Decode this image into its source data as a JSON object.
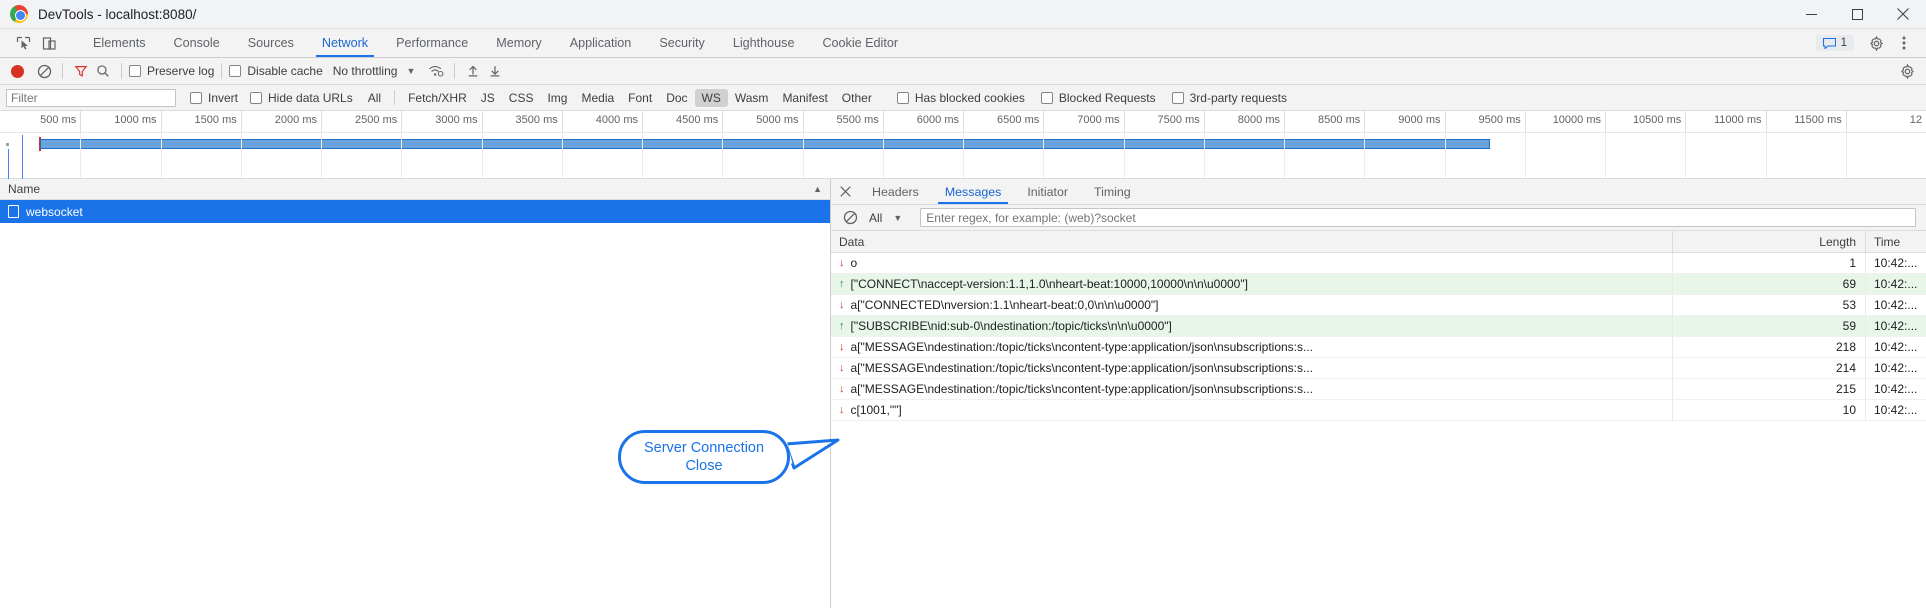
{
  "window": {
    "title": "DevTools - localhost:8080/",
    "controls": {
      "minimize": "minimize-icon",
      "maximize": "maximize-icon",
      "close": "close-icon"
    }
  },
  "devtools_tabs": {
    "items": [
      {
        "label": "Elements",
        "active": false
      },
      {
        "label": "Console",
        "active": false
      },
      {
        "label": "Sources",
        "active": false
      },
      {
        "label": "Network",
        "active": true
      },
      {
        "label": "Performance",
        "active": false
      },
      {
        "label": "Memory",
        "active": false
      },
      {
        "label": "Application",
        "active": false
      },
      {
        "label": "Security",
        "active": false
      },
      {
        "label": "Lighthouse",
        "active": false
      },
      {
        "label": "Cookie Editor",
        "active": false
      }
    ],
    "message_count": "1",
    "settings_icon": "gear-icon",
    "more_icon": "kebab-menu-icon",
    "inspect_icon": "inspect-element-icon",
    "device_icon": "device-toolbar-icon"
  },
  "network_toolbar": {
    "record_label": "record-button",
    "clear_label": "clear-button",
    "filter_icon_label": "filter-funnel-icon",
    "search_icon_label": "search-icon",
    "preserve_log": "Preserve log",
    "disable_cache": "Disable cache",
    "throttling": "No throttling",
    "wifi_icon": "network-conditions-icon",
    "import_icon": "import-har-icon",
    "export_icon": "export-har-icon",
    "settings_icon": "network-settings-gear-icon"
  },
  "filter_bar": {
    "filter_placeholder": "Filter",
    "invert": "Invert",
    "hide_data_urls": "Hide data URLs",
    "types": [
      {
        "label": "All",
        "selected": false
      },
      {
        "label": "Fetch/XHR",
        "selected": false
      },
      {
        "label": "JS",
        "selected": false
      },
      {
        "label": "CSS",
        "selected": false
      },
      {
        "label": "Img",
        "selected": false
      },
      {
        "label": "Media",
        "selected": false
      },
      {
        "label": "Font",
        "selected": false
      },
      {
        "label": "Doc",
        "selected": false
      },
      {
        "label": "WS",
        "selected": true
      },
      {
        "label": "Wasm",
        "selected": false
      },
      {
        "label": "Manifest",
        "selected": false
      },
      {
        "label": "Other",
        "selected": false
      }
    ],
    "has_blocked_cookies": "Has blocked cookies",
    "blocked_requests": "Blocked Requests",
    "third_party_requests": "3rd-party requests"
  },
  "timeline": {
    "ticks": [
      "500 ms",
      "1000 ms",
      "1500 ms",
      "2000 ms",
      "2500 ms",
      "3000 ms",
      "3500 ms",
      "4000 ms",
      "4500 ms",
      "5000 ms",
      "5500 ms",
      "6000 ms",
      "6500 ms",
      "7000 ms",
      "7500 ms",
      "8000 ms",
      "8500 ms",
      "9000 ms",
      "9500 ms",
      "10000 ms",
      "10500 ms",
      "11000 ms",
      "11500 ms",
      "12"
    ]
  },
  "requests": {
    "column_header": "Name",
    "rows": [
      {
        "name": "websocket",
        "selected": true
      }
    ]
  },
  "detail_panel": {
    "close_icon": "close-icon",
    "tabs": [
      {
        "label": "Headers",
        "active": false
      },
      {
        "label": "Messages",
        "active": true
      },
      {
        "label": "Initiator",
        "active": false
      },
      {
        "label": "Timing",
        "active": false
      }
    ],
    "message_filter": {
      "clear_icon": "clear-messages-icon",
      "selected_type": "All",
      "regex_placeholder": "Enter regex, for example: (web)?socket"
    },
    "table": {
      "columns": [
        "Data",
        "Length",
        "Time"
      ],
      "rows": [
        {
          "direction": "in",
          "data": "o",
          "length": "1",
          "time": "10:42:..."
        },
        {
          "direction": "out",
          "data": "[\"CONNECT\\naccept-version:1.1,1.0\\nheart-beat:10000,10000\\n\\n\\u0000\"]",
          "length": "69",
          "time": "10:42:..."
        },
        {
          "direction": "in",
          "data": "a[\"CONNECTED\\nversion:1.1\\nheart-beat:0,0\\n\\n\\u0000\"]",
          "length": "53",
          "time": "10:42:..."
        },
        {
          "direction": "out",
          "data": "[\"SUBSCRIBE\\nid:sub-0\\ndestination:/topic/ticks\\n\\n\\u0000\"]",
          "length": "59",
          "time": "10:42:..."
        },
        {
          "direction": "in",
          "data": "a[\"MESSAGE\\ndestination:/topic/ticks\\ncontent-type:application/json\\nsubscriptions:s...",
          "length": "218",
          "time": "10:42:..."
        },
        {
          "direction": "in",
          "data": "a[\"MESSAGE\\ndestination:/topic/ticks\\ncontent-type:application/json\\nsubscriptions:s...",
          "length": "214",
          "time": "10:42:..."
        },
        {
          "direction": "in",
          "data": "a[\"MESSAGE\\ndestination:/topic/ticks\\ncontent-type:application/json\\nsubscriptions:s...",
          "length": "215",
          "time": "10:42:..."
        },
        {
          "direction": "in",
          "data": "c[1001,\"\"]",
          "length": "10",
          "time": "10:42:..."
        }
      ]
    }
  },
  "annotation": {
    "text_line1": "Server Connection",
    "text_line2": "Close",
    "color": "#1a73e8"
  }
}
